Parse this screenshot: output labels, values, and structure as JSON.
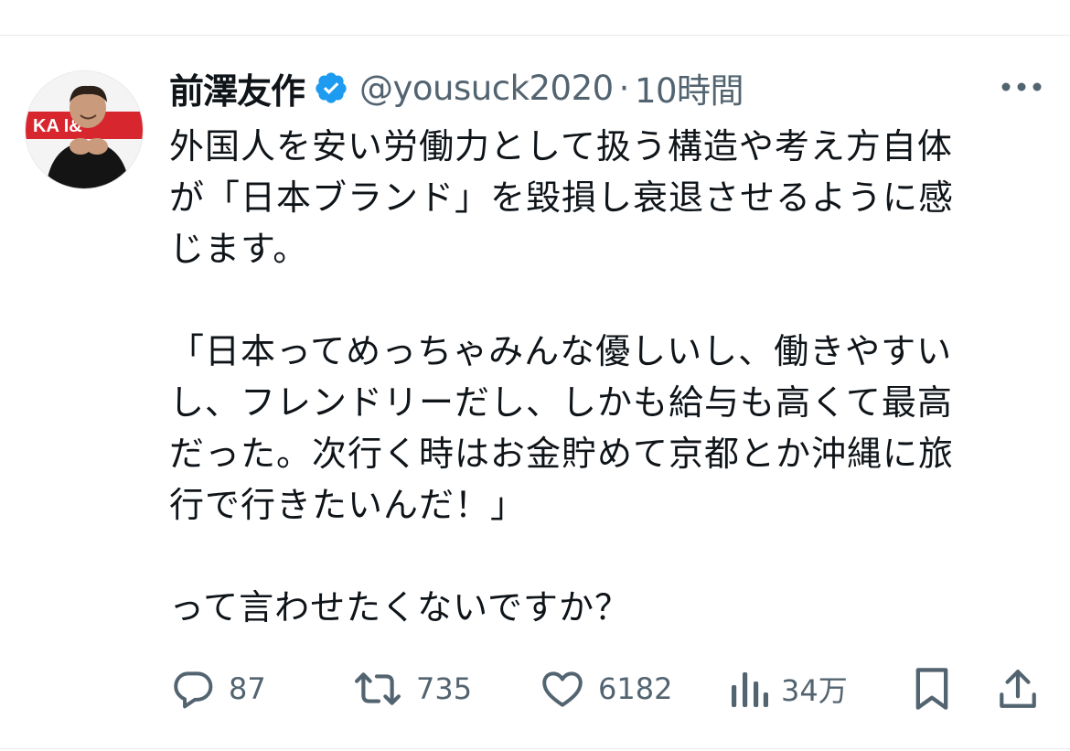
{
  "tweet": {
    "author_name": "前澤友作",
    "handle": "@yousuck2020",
    "separator": "·",
    "timestamp": "10時間",
    "avatar_text": "KA  I&",
    "lines": [
      "外国人を安い労働力として扱う構造や考え方自体",
      "が「日本ブランド」を毀損し衰退させるように感",
      "じます。",
      "",
      "「日本ってめっちゃみんな優しいし、働きやすい",
      "し、フレンドリーだし、しかも給与も高くて最高",
      "だった。次行く時はお金貯めて京都とか沖縄に旅",
      "行で行きたいんだ！」",
      "",
      "って言わせたくないですか？"
    ]
  },
  "actions": {
    "reply": {
      "icon": "reply-icon",
      "count": "87"
    },
    "retweet": {
      "icon": "retweet-icon",
      "count": "735"
    },
    "like": {
      "icon": "heart-icon",
      "count": "6182"
    },
    "views": {
      "icon": "views-icon",
      "count": "34万"
    },
    "bookmark": {
      "icon": "bookmark-icon"
    },
    "share": {
      "icon": "share-icon"
    }
  },
  "colors": {
    "text": "#0f1419",
    "secondary": "#536471",
    "verified": "#1d9bf0",
    "divider": "#e6e9ec",
    "avatar_banner": "#d8262f"
  }
}
